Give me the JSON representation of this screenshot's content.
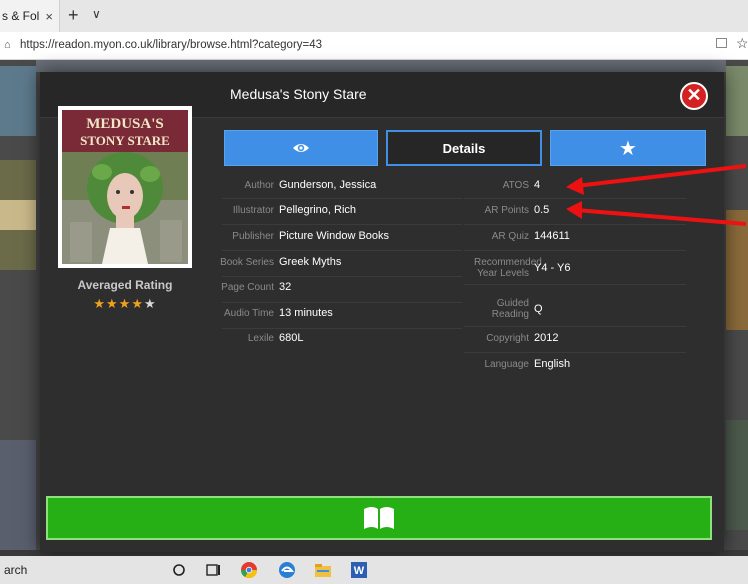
{
  "browser": {
    "tab_title": "s & Fol",
    "tab_close": "×",
    "new_tab": "+",
    "tab_menu": "∨",
    "url": "https://readon.myon.co.uk/library/browse.html?category=43"
  },
  "modal": {
    "title": "Medusa's Stony Stare",
    "close_glyph": "✕",
    "cover_title_line1": "MEDUSA'S",
    "cover_title_line2": "STONY STARE",
    "rating_label": "Averaged Rating",
    "rating": 4,
    "rating_max": 5,
    "tabs": {
      "preview_icon": "eye-icon",
      "details_label": "Details",
      "favorite_icon": "star-icon"
    },
    "left_details": [
      {
        "label": "Author",
        "value": "Gunderson, Jessica"
      },
      {
        "label": "Illustrator",
        "value": "Pellegrino, Rich"
      },
      {
        "label": "Publisher",
        "value": "Picture Window Books"
      },
      {
        "label": "Book Series",
        "value": "Greek Myths"
      },
      {
        "label": "Page Count",
        "value": "32"
      },
      {
        "label": "Audio Time",
        "value": "13 minutes"
      },
      {
        "label": "Lexile",
        "value": "680L"
      }
    ],
    "right_details": [
      {
        "label": "ATOS",
        "value": "4"
      },
      {
        "label": "AR Points",
        "value": "0.5"
      },
      {
        "label": "AR Quiz",
        "value": "144611"
      },
      {
        "label": "Recommended Year Levels",
        "value": "Y4 - Y6"
      },
      {
        "label": "Guided Reading",
        "value": "Q"
      },
      {
        "label": "Copyright",
        "value": "2012"
      },
      {
        "label": "Language",
        "value": "English"
      }
    ],
    "read_button_icon": "open-book-icon"
  },
  "taskbar": {
    "search_text": "arch"
  },
  "colors": {
    "accent_blue": "#3f8fe6",
    "read_green": "#26b016",
    "close_red": "#d42222",
    "arrow_red": "#ee1111"
  }
}
